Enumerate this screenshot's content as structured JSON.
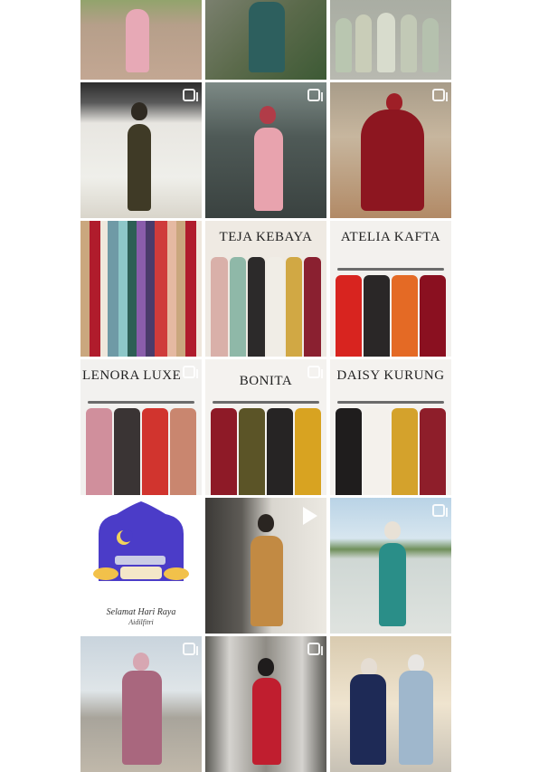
{
  "feed": {
    "posts": [
      {
        "id": 1,
        "type": "photo"
      },
      {
        "id": 2,
        "type": "photo"
      },
      {
        "id": 3,
        "type": "photo"
      },
      {
        "id": 4,
        "type": "carousel"
      },
      {
        "id": 5,
        "type": "carousel"
      },
      {
        "id": 6,
        "type": "carousel"
      },
      {
        "id": 7,
        "type": "photo"
      },
      {
        "id": 8,
        "type": "photo",
        "title": "TEJA KEBAYA"
      },
      {
        "id": 9,
        "type": "photo",
        "title": "ATELIA KAFTA"
      },
      {
        "id": 10,
        "type": "carousel",
        "title": "LENORA LUXE"
      },
      {
        "id": 11,
        "type": "carousel",
        "title": "BONITA"
      },
      {
        "id": 12,
        "type": "photo",
        "title": "DAISY KURUNG"
      },
      {
        "id": 13,
        "type": "photo",
        "caption_line1": "Selamat Hari Raya",
        "caption_line2": "Aidilfitri"
      },
      {
        "id": 14,
        "type": "video"
      },
      {
        "id": 15,
        "type": "carousel"
      },
      {
        "id": 16,
        "type": "carousel"
      },
      {
        "id": 17,
        "type": "carousel"
      },
      {
        "id": 18,
        "type": "photo"
      }
    ]
  },
  "colors": {
    "background": "#ffffff",
    "accent_blue": "#4b3cc8"
  }
}
